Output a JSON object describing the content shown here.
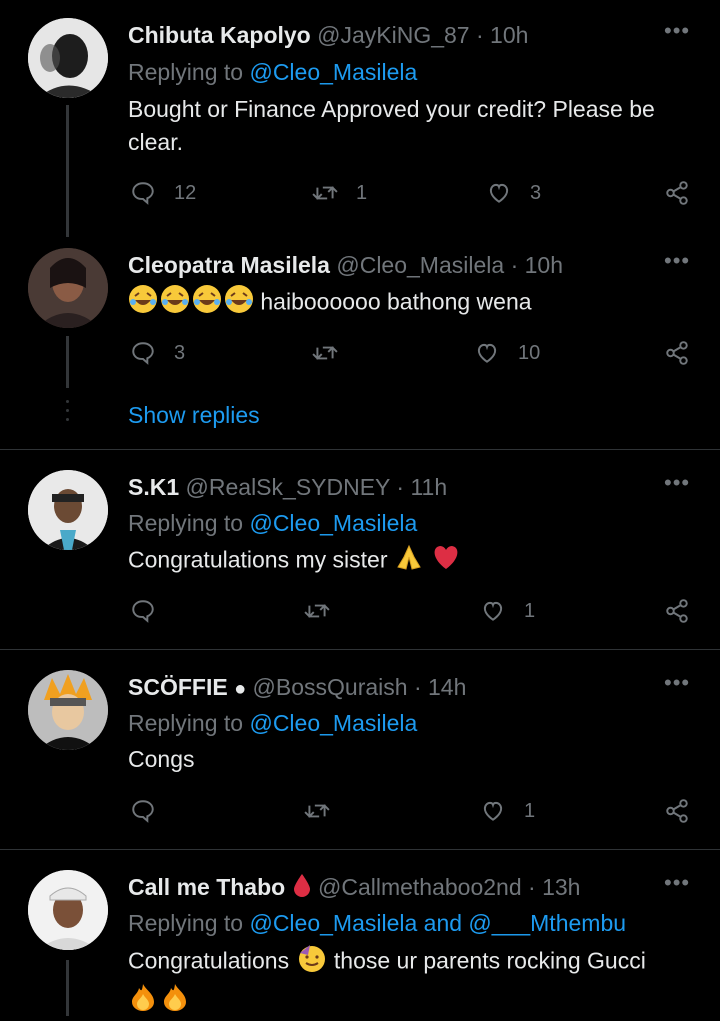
{
  "tweets": [
    {
      "name": "Chibuta Kapolyo",
      "handle": "@JayKiNG_87",
      "time": "10h",
      "replying_prefix": "Replying to",
      "replying_to": "@Cleo_Masilela",
      "text": "Bought or Finance Approved your credit? Please be clear.",
      "replies": "12",
      "retweets": "1",
      "likes": "3"
    },
    {
      "name": "Cleopatra Masilela",
      "handle": "@Cleo_Masilela",
      "time": "10h",
      "text": "haiboooooo bathong wena",
      "replies": "3",
      "retweets": "",
      "likes": "10",
      "show_replies": "Show replies"
    },
    {
      "name": "S.K1",
      "handle": "@RealSk_SYDNEY",
      "time": "11h",
      "replying_prefix": "Replying to",
      "replying_to": "@Cleo_Masilela",
      "text": "Congratulations my sister",
      "replies": "",
      "retweets": "",
      "likes": "1"
    },
    {
      "name": "SCÖFFIE",
      "handle": "@BossQuraish",
      "time": "14h",
      "replying_prefix": "Replying to",
      "replying_to": "@Cleo_Masilela",
      "text": "Congs",
      "replies": "",
      "retweets": "",
      "likes": "1"
    },
    {
      "name": "Call me Thabo",
      "handle": "@Callmethaboo2nd",
      "time": "13h",
      "replying_prefix": "Replying to",
      "replying_to": "@Cleo_Masilela and @___Mthembu",
      "text_part1": "Congratulations",
      "text_part2": "those ur parents rocking Gucci"
    }
  ],
  "colors": {
    "background": "#000000",
    "text": "#e7e9ea",
    "muted": "#71767b",
    "link": "#1d9bf0"
  }
}
